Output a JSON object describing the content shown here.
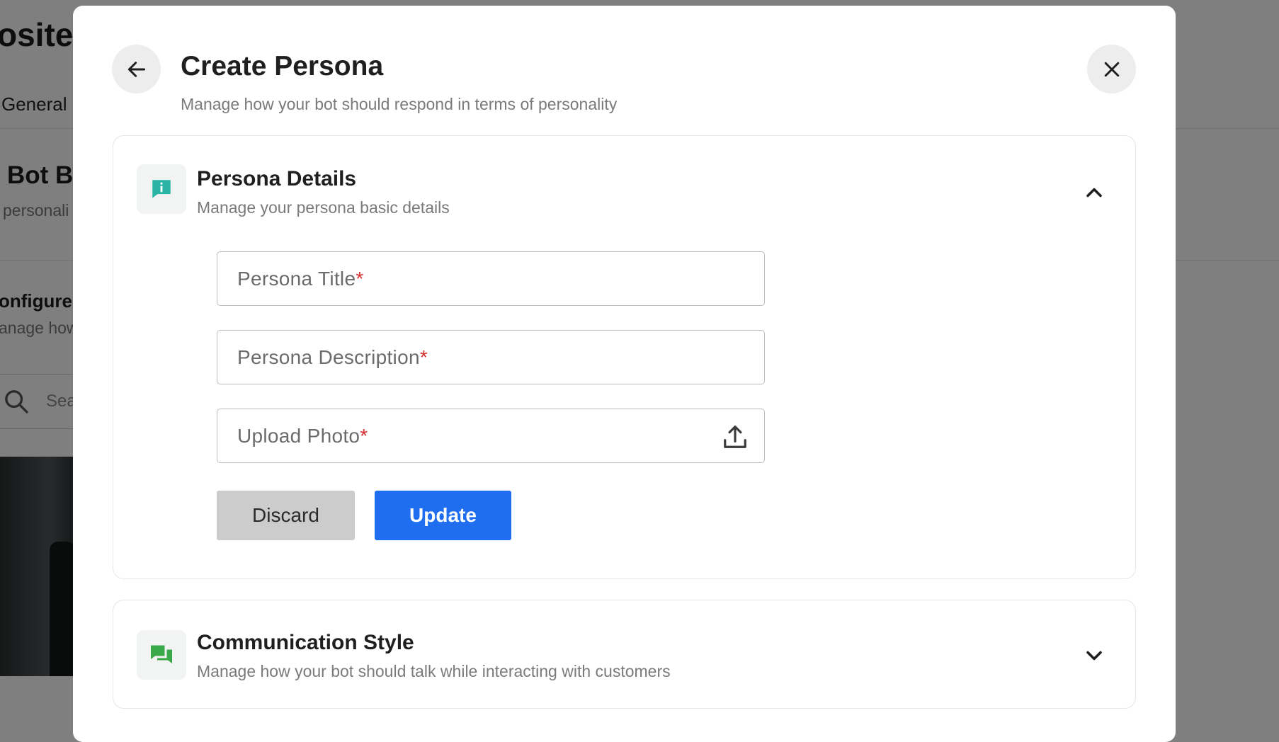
{
  "background": {
    "title": "osite C",
    "tab": "General",
    "section_title": "Bot Br",
    "section_sub": "personali",
    "config_title": "onfigure",
    "config_sub": "anage how",
    "search_placeholder": "Sea"
  },
  "modal": {
    "title": "Create Persona",
    "subtitle": "Manage how your bot should respond in terms of personality",
    "back_icon": "arrow-left-icon",
    "close_icon": "close-icon"
  },
  "persona_details": {
    "title": "Persona Details",
    "subtitle": "Manage your persona basic details",
    "icon": "chat-info-icon",
    "icon_color": "#2bb3a8",
    "expanded": true,
    "fields": {
      "title_label": "Persona Title",
      "description_label": "Persona Description",
      "photo_label": "Upload Photo",
      "required_mark": "*"
    },
    "discard_label": "Discard",
    "update_label": "Update"
  },
  "communication_style": {
    "title": "Communication Style",
    "subtitle": "Manage how your bot should talk while interacting with customers",
    "icon": "chat-bubbles-icon",
    "icon_color": "#3aa94a",
    "expanded": false
  },
  "colors": {
    "primary": "#1f6ef0",
    "required": "#d32f2f",
    "discard_bg": "#cccccc"
  }
}
